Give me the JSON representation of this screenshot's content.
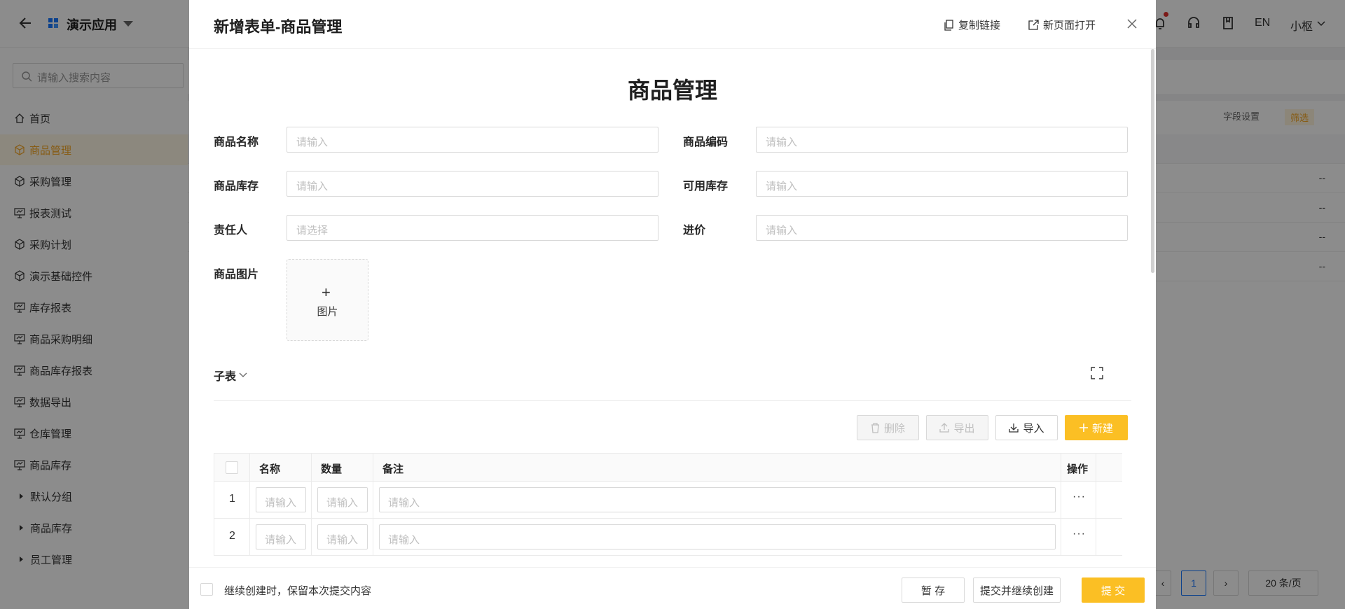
{
  "app": {
    "title": "演示应用",
    "lang": "EN",
    "user": "小枢"
  },
  "sidebar": {
    "search_placeholder": "请输入搜索内容",
    "items": [
      {
        "label": "首页",
        "icon": "home-icon"
      },
      {
        "label": "商品管理",
        "icon": "cube-icon",
        "active": true
      },
      {
        "label": "采购管理",
        "icon": "cube-icon"
      },
      {
        "label": "报表测试",
        "icon": "chart-icon"
      },
      {
        "label": "采购计划",
        "icon": "cube-icon"
      },
      {
        "label": "演示基础控件",
        "icon": "cube-icon"
      },
      {
        "label": "库存报表",
        "icon": "chart-icon"
      },
      {
        "label": "商品采购明细",
        "icon": "chart-icon"
      },
      {
        "label": "商品库存报表",
        "icon": "chart-icon"
      },
      {
        "label": "数据导出",
        "icon": "chart-icon"
      },
      {
        "label": "仓库管理",
        "icon": "chart-icon"
      },
      {
        "label": "商品库存",
        "icon": "chart-icon"
      }
    ],
    "groups": [
      "默认分组",
      "商品库存",
      "员工管理"
    ]
  },
  "background": {
    "field_settings": "字段设置",
    "filter": "筛选",
    "row_value": "--",
    "page": "1",
    "page_size": "20 条/页"
  },
  "modal": {
    "title": "新增表单-商品管理",
    "copy_link": "复制链接",
    "open_new_page": "新页面打开",
    "form_title": "商品管理",
    "fields": {
      "name": {
        "label": "商品名称",
        "placeholder": "请输入"
      },
      "code": {
        "label": "商品编码",
        "placeholder": "请输入"
      },
      "stock": {
        "label": "商品库存",
        "placeholder": "请输入"
      },
      "available": {
        "label": "可用库存",
        "placeholder": "请输入"
      },
      "owner": {
        "label": "责任人",
        "placeholder": "请选择"
      },
      "price": {
        "label": "进价",
        "placeholder": "请输入"
      },
      "image": {
        "label": "商品图片",
        "upload_text": "图片"
      }
    },
    "subtable": {
      "title": "子表",
      "buttons": {
        "delete": "删除",
        "export": "导出",
        "import": "导入",
        "new": "新建"
      },
      "columns": {
        "name": "名称",
        "qty": "数量",
        "note": "备注",
        "ops": "操作"
      },
      "rows": [
        {
          "index": "1",
          "placeholder": "请输入",
          "more": "···"
        },
        {
          "index": "2",
          "placeholder": "请输入",
          "more": "···"
        }
      ]
    },
    "footer": {
      "keep_text": "继续创建时，保留本次提交内容",
      "save_draft": "暂 存",
      "submit_continue": "提交并继续创建",
      "submit": "提 交"
    }
  },
  "colors": {
    "accent": "#fbbf24",
    "active_text": "#f5a623"
  }
}
